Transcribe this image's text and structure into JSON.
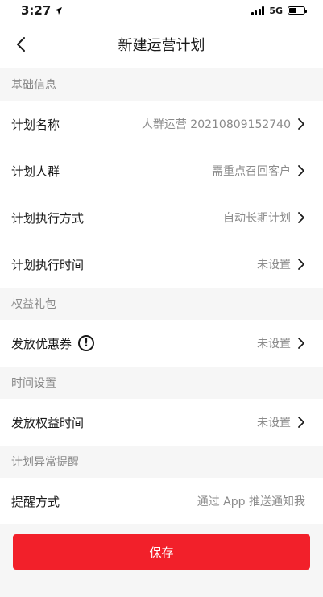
{
  "status_bar": {
    "time": "3:27",
    "network": "5G",
    "battery_level": 0.55
  },
  "nav": {
    "title": "新建运营计划"
  },
  "sections": {
    "basic": {
      "title": "基础信息",
      "rows": [
        {
          "label": "计划名称",
          "value": "人群运营 20210809152740"
        },
        {
          "label": "计划人群",
          "value": "需重点召回客户"
        },
        {
          "label": "计划执行方式",
          "value": "自动长期计划"
        },
        {
          "label": "计划执行时间",
          "value": "未设置"
        }
      ]
    },
    "gift": {
      "title": "权益礼包",
      "rows": [
        {
          "label": "发放优惠券",
          "value": "未设置"
        }
      ]
    },
    "time": {
      "title": "时间设置",
      "rows": [
        {
          "label": "发放权益时间",
          "value": "未设置"
        }
      ]
    },
    "alert": {
      "title": "计划异常提醒",
      "rows": [
        {
          "label": "提醒方式",
          "value": "通过 App 推送通知我"
        }
      ]
    }
  },
  "footer": {
    "save_label": "保存"
  },
  "colors": {
    "accent": "#f2202a",
    "background": "#f6f6f6",
    "muted_text": "#8a8a8a"
  }
}
